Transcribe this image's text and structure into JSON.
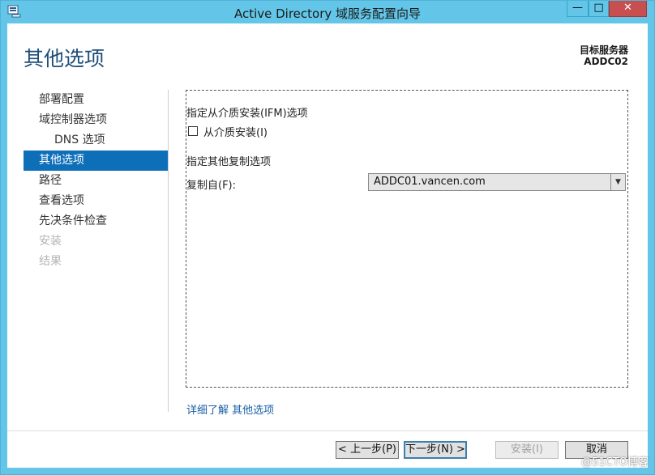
{
  "window": {
    "title": "Active Directory 域服务配置向导",
    "minimize_glyph": "—",
    "maximize_glyph": "□",
    "close_glyph": "✕",
    "app_icon": "server-icon"
  },
  "header": {
    "page_title": "其他选项",
    "target_label": "目标服务器",
    "target_value": "ADDC02"
  },
  "nav": {
    "items": [
      {
        "label": "部署配置",
        "state": "normal"
      },
      {
        "label": "域控制器选项",
        "state": "normal"
      },
      {
        "label": "DNS 选项",
        "state": "sub"
      },
      {
        "label": "其他选项",
        "state": "active"
      },
      {
        "label": "路径",
        "state": "normal"
      },
      {
        "label": "查看选项",
        "state": "normal"
      },
      {
        "label": "先决条件检查",
        "state": "normal"
      },
      {
        "label": "安装",
        "state": "disabled"
      },
      {
        "label": "结果",
        "state": "disabled"
      }
    ]
  },
  "content": {
    "ifm_section": "指定从介质安装(IFM)选项",
    "ifm_checkbox_label": "从介质安装(I)",
    "ifm_checked": false,
    "replication_section": "指定其他复制选项",
    "replicate_from_label": "复制自(F):",
    "replicate_from_value": "ADDC01.vancen.com"
  },
  "more_link": "详细了解 其他选项",
  "footer": {
    "prev": "< 上一步(P)",
    "next": "下一步(N) >",
    "install": "安装(I)",
    "cancel": "取消"
  },
  "watermark": "@51CTO博客",
  "colors": {
    "titlebar": "#63c6e8",
    "accent": "#0e6fb9",
    "close": "#c74f4f"
  }
}
